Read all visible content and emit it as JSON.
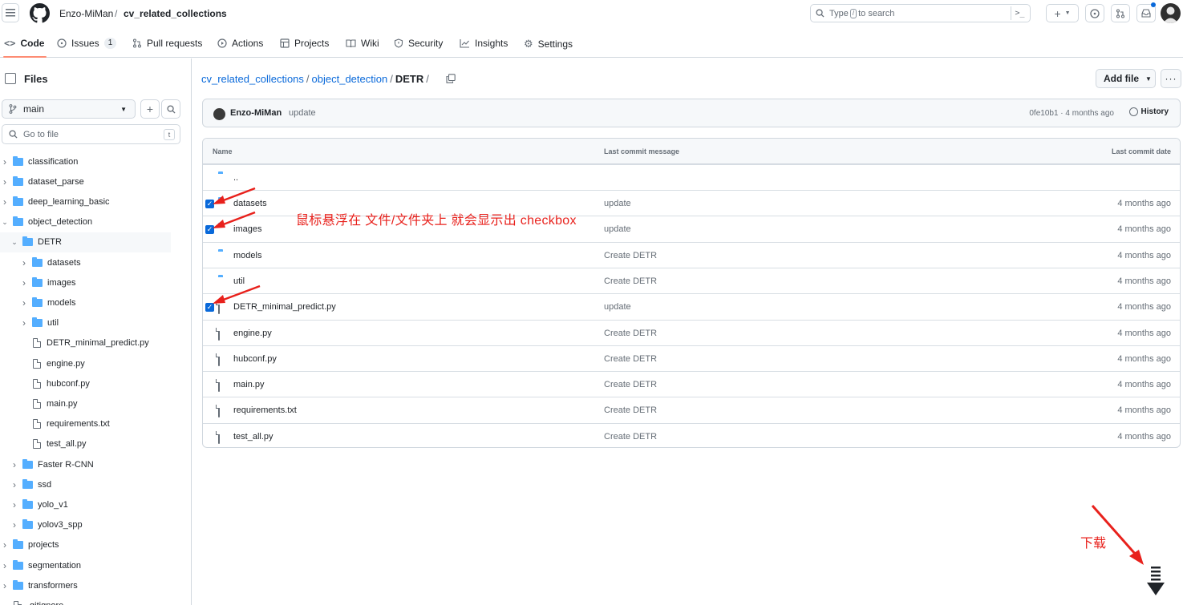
{
  "header": {
    "owner": "Enzo-MiMan",
    "separator": "/",
    "repo": "cv_related_collections",
    "search_prefix": "Type",
    "search_key": "/",
    "search_suffix": "to search",
    "cmd_glyph": ">_"
  },
  "repo_nav": {
    "items": [
      {
        "label": "Code"
      },
      {
        "label": "Issues",
        "count": "1"
      },
      {
        "label": "Pull requests"
      },
      {
        "label": "Actions"
      },
      {
        "label": "Projects"
      },
      {
        "label": "Wiki"
      },
      {
        "label": "Security"
      },
      {
        "label": "Insights"
      },
      {
        "label": "Settings"
      }
    ]
  },
  "sidebar": {
    "title": "Files",
    "branch": "main",
    "goto_placeholder": "Go to file",
    "goto_key": "t",
    "tree": [
      {
        "label": "classification",
        "kind": "folder",
        "depth": 0
      },
      {
        "label": "dataset_parse",
        "kind": "folder",
        "depth": 0
      },
      {
        "label": "deep_learning_basic",
        "kind": "folder",
        "depth": 0
      },
      {
        "label": "object_detection",
        "kind": "folder",
        "depth": 0,
        "open": true
      },
      {
        "label": "DETR",
        "kind": "folder",
        "depth": 1,
        "open": true,
        "selected": true
      },
      {
        "label": "datasets",
        "kind": "folder",
        "depth": 2
      },
      {
        "label": "images",
        "kind": "folder",
        "depth": 2
      },
      {
        "label": "models",
        "kind": "folder",
        "depth": 2
      },
      {
        "label": "util",
        "kind": "folder",
        "depth": 2
      },
      {
        "label": "DETR_minimal_predict.py",
        "kind": "file",
        "depth": 2
      },
      {
        "label": "engine.py",
        "kind": "file",
        "depth": 2
      },
      {
        "label": "hubconf.py",
        "kind": "file",
        "depth": 2
      },
      {
        "label": "main.py",
        "kind": "file",
        "depth": 2
      },
      {
        "label": "requirements.txt",
        "kind": "file",
        "depth": 2
      },
      {
        "label": "test_all.py",
        "kind": "file",
        "depth": 2
      },
      {
        "label": "Faster R-CNN",
        "kind": "folder",
        "depth": 1
      },
      {
        "label": "ssd",
        "kind": "folder",
        "depth": 1
      },
      {
        "label": "yolo_v1",
        "kind": "folder",
        "depth": 1
      },
      {
        "label": "yolov3_spp",
        "kind": "folder",
        "depth": 1
      },
      {
        "label": "projects",
        "kind": "folder",
        "depth": 0
      },
      {
        "label": "segmentation",
        "kind": "folder",
        "depth": 0
      },
      {
        "label": "transformers",
        "kind": "folder",
        "depth": 0
      },
      {
        "label": ".gitignore",
        "kind": "file",
        "depth": 0
      }
    ]
  },
  "breadcrumb": {
    "root": "cv_related_collections",
    "mid": "object_detection",
    "current": "DETR",
    "sep": "/"
  },
  "toolbar": {
    "add_file": "Add file",
    "more": "···"
  },
  "commit": {
    "author": "Enzo-MiMan",
    "message": "update",
    "meta": "0fe10b1 · 4 months ago",
    "history": "History"
  },
  "table": {
    "headers": {
      "name": "Name",
      "message": "Last commit message",
      "date": "Last commit date"
    },
    "parent": "..",
    "rows": [
      {
        "name": "datasets",
        "kind": "folder",
        "message": "update",
        "date": "4 months ago",
        "checked": true
      },
      {
        "name": "images",
        "kind": "folder",
        "message": "update",
        "date": "4 months ago",
        "checked": true
      },
      {
        "name": "models",
        "kind": "folder",
        "message": "Create DETR",
        "date": "4 months ago",
        "checked": false
      },
      {
        "name": "util",
        "kind": "folder",
        "message": "Create DETR",
        "date": "4 months ago",
        "checked": false
      },
      {
        "name": "DETR_minimal_predict.py",
        "kind": "file",
        "message": "update",
        "date": "4 months ago",
        "checked": true
      },
      {
        "name": "engine.py",
        "kind": "file",
        "message": "Create DETR",
        "date": "4 months ago",
        "checked": false
      },
      {
        "name": "hubconf.py",
        "kind": "file",
        "message": "Create DETR",
        "date": "4 months ago",
        "checked": false
      },
      {
        "name": "main.py",
        "kind": "file",
        "message": "Create DETR",
        "date": "4 months ago",
        "checked": false
      },
      {
        "name": "requirements.txt",
        "kind": "file",
        "message": "Create DETR",
        "date": "4 months ago",
        "checked": false
      },
      {
        "name": "test_all.py",
        "kind": "file",
        "message": "Create DETR",
        "date": "4 months ago",
        "checked": false
      }
    ]
  },
  "annotations": {
    "hover_note": "鼠标悬浮在 文件/文件夹上 就会显示出 checkbox",
    "download_note": "下载",
    "color": "#e8211c"
  },
  "colors": {
    "link": "#0969da",
    "folder": "#54aeff",
    "nav_underline": "#fd8c73",
    "border": "#d0d7de"
  }
}
